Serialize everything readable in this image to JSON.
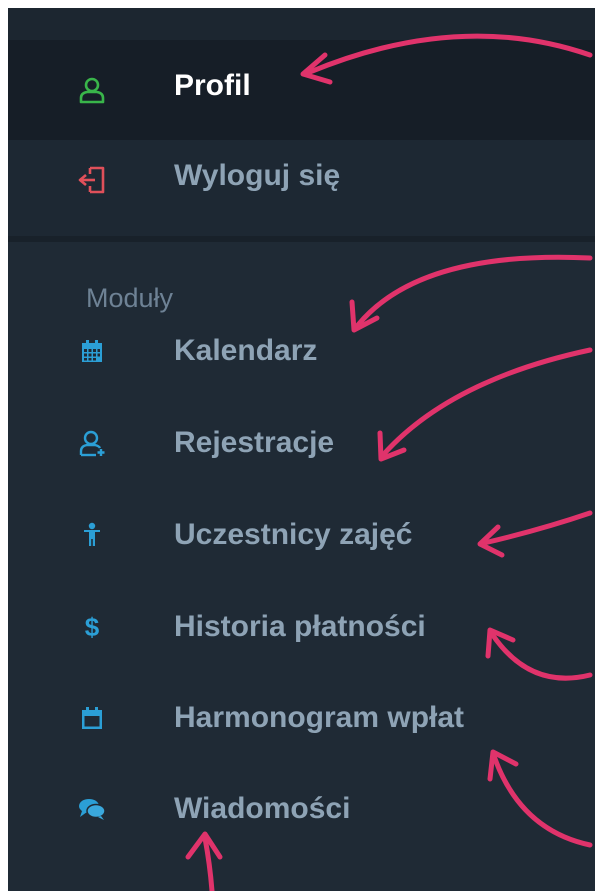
{
  "account_menu": {
    "items": [
      {
        "label": "Profil",
        "icon": "user-icon",
        "active": true
      },
      {
        "label": "Wyloguj się",
        "icon": "logout-icon",
        "active": false
      }
    ]
  },
  "modules": {
    "title": "Moduły",
    "items": [
      {
        "label": "Kalendarz",
        "icon": "calendar-icon"
      },
      {
        "label": "Rejestracje",
        "icon": "user-add-icon"
      },
      {
        "label": "Uczestnicy zajęć",
        "icon": "person-icon"
      },
      {
        "label": "Historia płatności",
        "icon": "dollar-icon"
      },
      {
        "label": "Harmonogram wpłat",
        "icon": "calendar-empty-icon"
      },
      {
        "label": "Wiadomości",
        "icon": "chat-icon"
      }
    ]
  },
  "colors": {
    "sidebar_bg": "#1f2a35",
    "active_bg": "#161e27",
    "active_icon": "#39b54a",
    "logout_icon": "#e0505a",
    "module_icon": "#2b9fd6",
    "label": "#8ea3b5",
    "arrow": "#e0336b"
  }
}
